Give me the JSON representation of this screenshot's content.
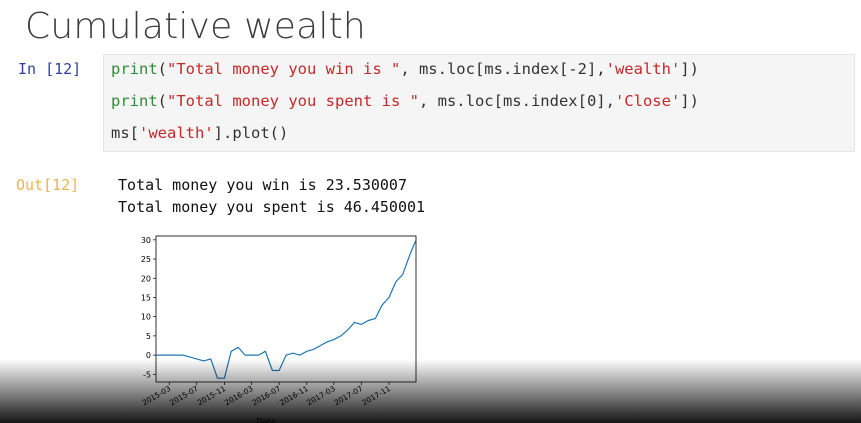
{
  "slide": {
    "title": "Cumulative wealth"
  },
  "cell": {
    "in_prompt": "In [12]",
    "out_prompt": "Out[12]",
    "code_lines": [
      {
        "func": "print",
        "text": "(\"Total money you win is \", ms.loc[ms.index[-2],'wealth'])"
      },
      {
        "func": "print",
        "text": "(\"Total money you spent is \", ms.loc[ms.index[0],'Close'])"
      },
      {
        "func": "",
        "text": "ms['wealth'].plot()"
      }
    ],
    "output_lines": [
      "Total money you win is 23.530007",
      "Total money you spent is 46.450001"
    ]
  },
  "chart_data": {
    "type": "line",
    "title": "",
    "xlabel": "Date",
    "ylabel": "",
    "ylim": [
      -7,
      31
    ],
    "yticks": [
      -5,
      0,
      5,
      10,
      15,
      20,
      25,
      30
    ],
    "xticks": [
      "2015-03",
      "2015-07",
      "2015-11",
      "2016-03",
      "2016-07",
      "2016-11",
      "2017-03",
      "2017-07",
      "2017-11"
    ],
    "series": [
      {
        "color": "#1f77b4",
        "x": [
          "2015-01",
          "2015-03",
          "2015-05",
          "2015-07",
          "2015-08",
          "2015-09",
          "2015-10",
          "2015-11",
          "2015-12",
          "2016-01",
          "2016-02",
          "2016-03",
          "2016-04",
          "2016-05",
          "2016-06",
          "2016-07",
          "2016-08",
          "2016-09",
          "2016-10",
          "2016-11",
          "2016-12",
          "2017-01",
          "2017-02",
          "2017-03",
          "2017-04",
          "2017-05",
          "2017-06",
          "2017-07",
          "2017-08",
          "2017-09",
          "2017-10",
          "2017-11",
          "2017-12",
          "2018-01",
          "2018-02",
          "2018-03"
        ],
        "y": [
          0,
          0,
          0,
          -1,
          -1.5,
          -1,
          -6,
          -6,
          1,
          2,
          0,
          0,
          0,
          1,
          -4,
          -4,
          0,
          0.5,
          0,
          1,
          1.5,
          2.5,
          3.5,
          4,
          5,
          6.5,
          8.5,
          8,
          9,
          9.5,
          13,
          15,
          19,
          21,
          26,
          30
        ]
      }
    ]
  }
}
